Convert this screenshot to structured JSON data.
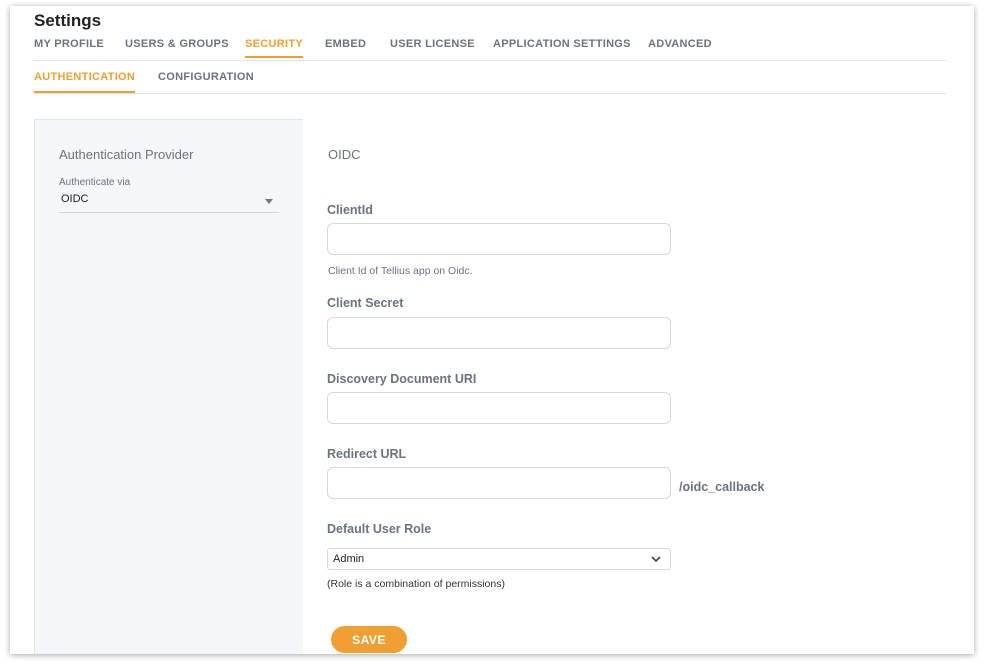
{
  "page": {
    "title": "Settings"
  },
  "tabs": [
    {
      "label": "MY PROFILE"
    },
    {
      "label": "USERS & GROUPS"
    },
    {
      "label": "SECURITY",
      "active": true
    },
    {
      "label": "EMBED"
    },
    {
      "label": "USER LICENSE"
    },
    {
      "label": "APPLICATION SETTINGS"
    },
    {
      "label": "ADVANCED"
    }
  ],
  "subtabs": [
    {
      "label": "AUTHENTICATION",
      "active": true
    },
    {
      "label": "CONFIGURATION"
    }
  ],
  "provider": {
    "heading": "Authentication Provider",
    "label": "Authenticate via",
    "selected": "OIDC"
  },
  "form": {
    "heading": "OIDC",
    "client_id": {
      "label": "ClientId",
      "value": "",
      "hint": "Client Id of Tellius app on Oidc."
    },
    "client_secret": {
      "label": "Client Secret",
      "value": ""
    },
    "discovery_uri": {
      "label": "Discovery Document URI",
      "value": ""
    },
    "redirect_url": {
      "label": "Redirect URL",
      "value": "",
      "suffix": "/oidc_callback"
    },
    "default_role": {
      "label": "Default User Role",
      "selected": "Admin",
      "hint": "(Role is a combination of permissions)"
    },
    "save_label": "SAVE"
  },
  "colors": {
    "accent": "#f0a033",
    "muted_text": "#6b7280",
    "panel_bg": "#f5f6f8"
  }
}
